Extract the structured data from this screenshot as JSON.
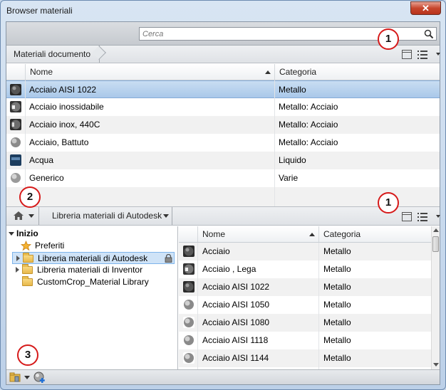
{
  "window": {
    "title": "Browser materiali",
    "close_glyph": "✕"
  },
  "search": {
    "placeholder": "Cerca",
    "icon": "search-icon"
  },
  "document": {
    "breadcrumb": "Materiali documento",
    "columns": {
      "name": "Nome",
      "category": "Categoria"
    },
    "rows": [
      {
        "name": "Acciaio AISI 1022",
        "category": "Metallo",
        "swatch": "dark-sphere"
      },
      {
        "name": "Acciaio inossidabile",
        "category": "Metallo: Acciaio",
        "swatch": "brushed-sphere"
      },
      {
        "name": "Acciaio inox, 440C",
        "category": "Metallo: Acciaio",
        "swatch": "steel-sphere"
      },
      {
        "name": "Acciaio, Battuto",
        "category": "Metallo: Acciaio",
        "swatch": "hammered-sphere"
      },
      {
        "name": "Acqua",
        "category": "Liquido",
        "swatch": "water-swatch"
      },
      {
        "name": "Generico",
        "category": "Varie",
        "swatch": "grey-sphere"
      }
    ]
  },
  "library": {
    "breadcrumb": "Libreria materiali di Autodesk",
    "tree": {
      "root": "Inizio",
      "items": [
        {
          "label": "Preferiti",
          "icon": "star-icon"
        },
        {
          "label": "Libreria materiali di Autodesk",
          "icon": "folder-icon",
          "locked": true
        },
        {
          "label": "Libreria materiali di Inventor",
          "icon": "folder-icon"
        },
        {
          "label": "CustomCrop_Material Library",
          "icon": "folder-icon"
        }
      ]
    },
    "columns": {
      "name": "Nome",
      "category": "Categoria"
    },
    "rows": [
      {
        "name": "Acciaio",
        "category": "Metallo"
      },
      {
        "name": "Acciaio , Lega",
        "category": "Metallo"
      },
      {
        "name": "Acciaio AISI 1022",
        "category": "Metallo"
      },
      {
        "name": "Acciaio AISI 1050",
        "category": "Metallo"
      },
      {
        "name": "Acciaio AISI 1080",
        "category": "Metallo"
      },
      {
        "name": "Acciaio AISI 1118",
        "category": "Metallo"
      },
      {
        "name": "Acciaio AISI 1144",
        "category": "Metallo"
      }
    ]
  },
  "callouts": [
    "1",
    "1",
    "2",
    "3"
  ],
  "colors": {
    "accent": "#a9c8e9",
    "callout_border": "#d61a1a"
  }
}
